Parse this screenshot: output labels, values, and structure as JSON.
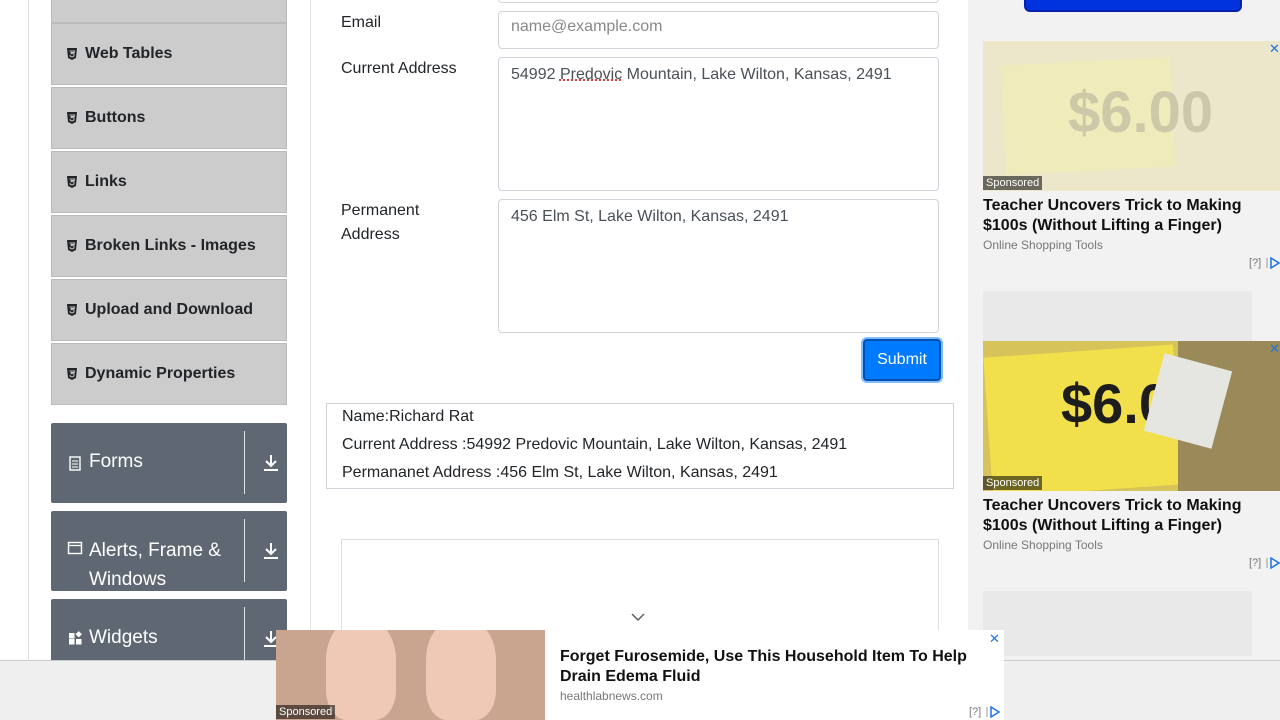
{
  "sidebar": {
    "items": [
      {
        "label": "Web Tables"
      },
      {
        "label": "Buttons"
      },
      {
        "label": "Links"
      },
      {
        "label": "Broken Links - Images"
      },
      {
        "label": "Upload and Download"
      },
      {
        "label": "Dynamic Properties"
      }
    ],
    "groups": [
      {
        "label": "Forms",
        "icon": "document-icon"
      },
      {
        "label": "Alerts, Frame &",
        "label2": "Windows",
        "icon": "window-icon"
      },
      {
        "label": "Widgets",
        "icon": "widgets-icon"
      }
    ]
  },
  "form": {
    "email_label": "Email",
    "email_placeholder": "name@example.com",
    "current_address_label": "Current Address",
    "current_address_value_prefix": "54992 ",
    "current_address_value_underlined": "Predovic",
    "current_address_value_suffix": " Mountain, Lake Wilton, Kansas, 2491",
    "permanent_address_label_line1": "Permanent",
    "permanent_address_label_line2": "Address",
    "permanent_address_value": "456 Elm St, Lake Wilton, Kansas, 2491",
    "submit_label": "Submit"
  },
  "output": {
    "name": "Name:Richard Rat",
    "current_address": "Current Address :54992 Predovic Mountain, Lake Wilton, Kansas, 2491",
    "permanent_address": "Permananet Address :456 Elm St, Lake Wilton, Kansas, 2491"
  },
  "ads": {
    "sponsored_label": "Sponsored",
    "right_ad_1": {
      "title": "Teacher Uncovers Trick to Making $100s (Without Lifting a Finger)",
      "source": "Online Shopping Tools",
      "info": "[?]"
    },
    "right_ad_2": {
      "title": "Teacher Uncovers Trick to Making $100s (Without Lifting a Finger)",
      "source": "Online Shopping Tools",
      "info": "[?]"
    },
    "bottom_ad": {
      "title": "Forget Furosemide, Use This Household Item To Help Drain Edema Fluid",
      "source": "healthlabnews.com",
      "info": "[?]"
    },
    "close_glyph": "✕",
    "price_text": "$6.00"
  },
  "colors": {
    "accent": "#007bff",
    "sidebar_group": "#5f6872",
    "menu_item": "#cccccc"
  }
}
